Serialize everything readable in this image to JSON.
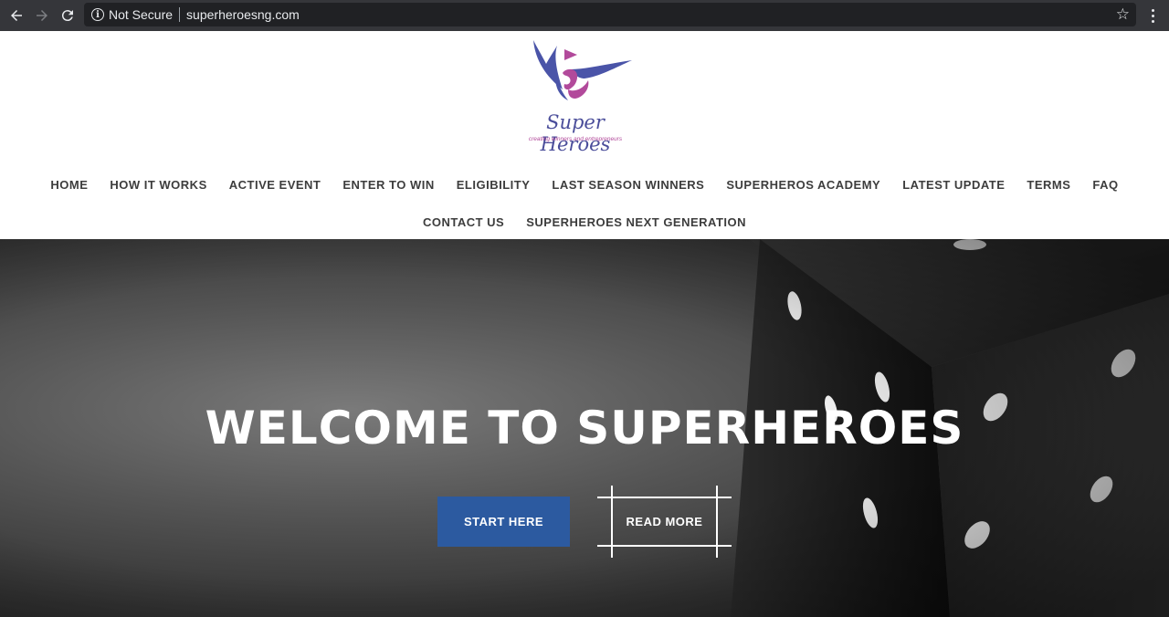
{
  "browser": {
    "security_text": "Not Secure",
    "url": "superheroesng.com",
    "icons": [
      "back-arrow-icon",
      "forward-arrow-icon",
      "reload-icon",
      "info-icon",
      "star-icon",
      "kebab-menu-icon"
    ]
  },
  "logo": {
    "title": "Super Heroes",
    "tagline": "creating winners and entrepreneurs"
  },
  "nav": {
    "row1": [
      "HOME",
      "HOW IT WORKS",
      "ACTIVE EVENT",
      "ENTER TO WIN",
      "ELIGIBILITY",
      "LAST SEASON WINNERS",
      "SUPERHEROS ACADEMY",
      "LATEST UPDATE",
      "TERMS",
      "FAQ"
    ],
    "row2": [
      "CONTACT US",
      "SUPERHEROES NEXT GENERATION"
    ]
  },
  "hero": {
    "title": "WELCOME TO SUPERHEROES",
    "primary_button": "START HERE",
    "secondary_button": "READ MORE"
  },
  "colors": {
    "primary_button": "#2c5aa0",
    "chrome": "#35363a",
    "nav_text": "#3d3d3d"
  }
}
